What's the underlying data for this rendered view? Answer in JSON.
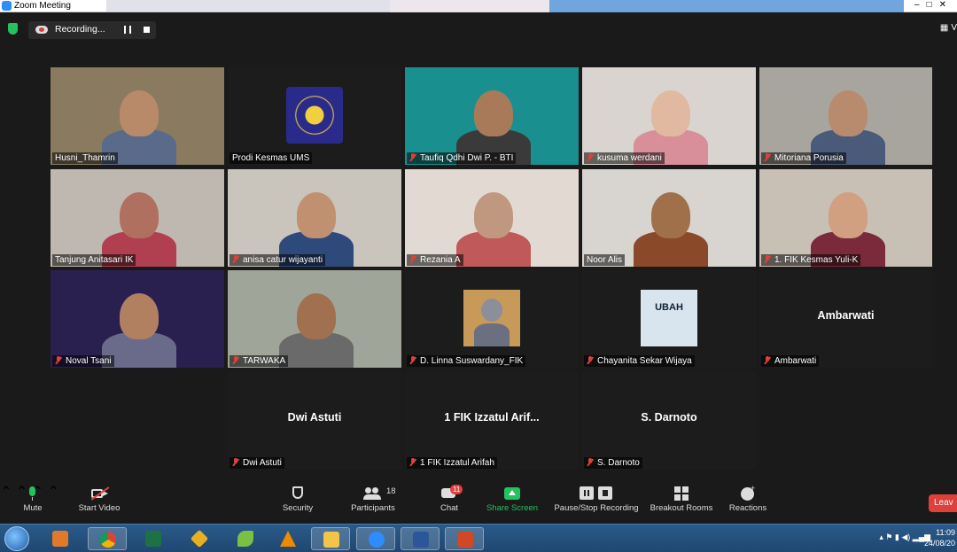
{
  "window": {
    "title": "Zoom Meeting"
  },
  "recording": {
    "label": "Recording..."
  },
  "view_label": "V",
  "participants": [
    {
      "name": "Husni_Thamrin",
      "muted": false,
      "bg": "#8a7a60",
      "skin": "#b98a6a",
      "cloth": "#5a6a8a"
    },
    {
      "name": "Prodi Kesmas UMS",
      "muted": false,
      "active": true,
      "bg": "#1c1c1c",
      "logo": true
    },
    {
      "name": "Taufiq Qdhi Dwi P. - BTI",
      "muted": true,
      "bg": "#1a8f8f",
      "skin": "#a97a5a",
      "cloth": "#3a3a3a"
    },
    {
      "name": "kusuma werdani",
      "muted": true,
      "bg": "#d9d4cf",
      "skin": "#e0b9a0",
      "cloth": "#d98f9a"
    },
    {
      "name": "Mitoriana Porusia",
      "muted": true,
      "bg": "#a8a59e",
      "skin": "#b88a6e",
      "cloth": "#4a5a7a"
    },
    {
      "name": "Tanjung Anitasari IK",
      "muted": false,
      "bg": "#bfb8b0",
      "skin": "#b07060",
      "cloth": "#b04050"
    },
    {
      "name": "anisa catur wijayanti",
      "muted": true,
      "bg": "#c9c4bc",
      "skin": "#c09070",
      "cloth": "#2e4a7a"
    },
    {
      "name": "Rezania A",
      "muted": true,
      "bg": "#e2dad2",
      "skin": "#c09880",
      "cloth": "#c05a5a"
    },
    {
      "name": "Noor Alis",
      "muted": false,
      "bg": "#d8d4d0",
      "skin": "#a0704a",
      "cloth": "#8a4a2a"
    },
    {
      "name": "1. FIK Kesmas Yuli-K",
      "muted": true,
      "bg": "#c8bfb5",
      "skin": "#d0a080",
      "cloth": "#7a2a3a"
    },
    {
      "name": "Noval Tsani",
      "muted": true,
      "bg": "#2a2050",
      "skin": "#b08060",
      "cloth": "#6a6a8a"
    },
    {
      "name": "TARWAKA",
      "muted": true,
      "bg": "#a0a59a",
      "skin": "#a07050",
      "cloth": "#6a6a6a"
    },
    {
      "name": "D. Linna Suswardany_FIK",
      "muted": true,
      "bg": "#1c1c1c",
      "thumb": "#c89a5a"
    },
    {
      "name": "Chayanita Sekar Wijaya",
      "muted": true,
      "bg": "#1c1c1c",
      "thumb": "#d8e4ee",
      "thumb_text": "UBAH"
    },
    {
      "name": "Ambarwati",
      "muted": true,
      "bg": "#1c1c1c",
      "display": "Ambarwati"
    },
    {
      "name": "Dwi Astuti",
      "muted": true,
      "bg": "#1c1c1c",
      "display": "Dwi Astuti"
    },
    {
      "name": "1 FIK Izzatul Arifah",
      "muted": true,
      "bg": "#1c1c1c",
      "display": "1 FIK Izzatul Arif..."
    },
    {
      "name": "S. Darnoto",
      "muted": true,
      "bg": "#1c1c1c",
      "display": "S. Darnoto"
    }
  ],
  "toolbar": {
    "mute": "Mute",
    "start_video": "Start Video",
    "security": "Security",
    "participants": "Participants",
    "participants_count": "18",
    "chat": "Chat",
    "chat_badge": "11",
    "share_screen": "Share Screen",
    "pause_recording": "Pause/Stop Recording",
    "breakout_rooms": "Breakout Rooms",
    "reactions": "Reactions",
    "leave": "Leav"
  },
  "taskbar": {
    "apps": [
      "media-player",
      "chrome",
      "excel",
      "app-yellow",
      "app-green",
      "vlc",
      "file-explorer",
      "zoom",
      "word",
      "powerpoint"
    ],
    "time": "11:09",
    "date": "24/08/20"
  },
  "colors": {
    "accent_green": "#23c25f",
    "mute_red": "#e0403a",
    "active_outline": "#c4e06a",
    "taskbar": "#2b5a8a"
  }
}
